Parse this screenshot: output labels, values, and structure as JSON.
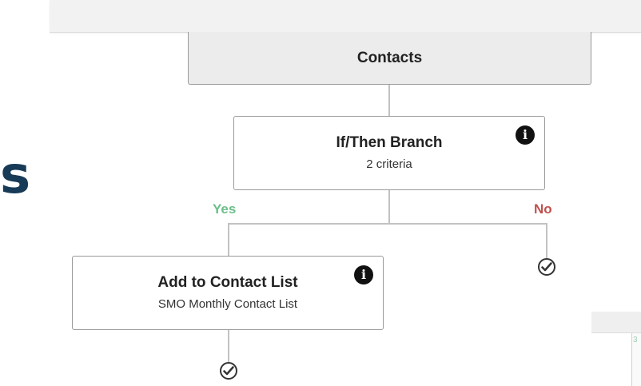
{
  "workflow": {
    "contacts_node": {
      "title": "Contacts"
    },
    "ifthen_node": {
      "title": "If/Then Branch",
      "subtitle": "2 criteria"
    },
    "branches": {
      "yes_label": "Yes",
      "no_label": "No"
    },
    "add_list_node": {
      "title": "Add to Contact List",
      "subtitle": "SMO Monthly Contact List"
    }
  },
  "background": {
    "partial_text": "s"
  },
  "side_panel": {
    "partial_text": "3"
  },
  "icons": {
    "info": "info-icon",
    "end": "check-circle-icon"
  },
  "colors": {
    "yes": "#6cbf8a",
    "no": "#c0504d",
    "heading": "#173b57",
    "connector": "#c2c2c2"
  }
}
